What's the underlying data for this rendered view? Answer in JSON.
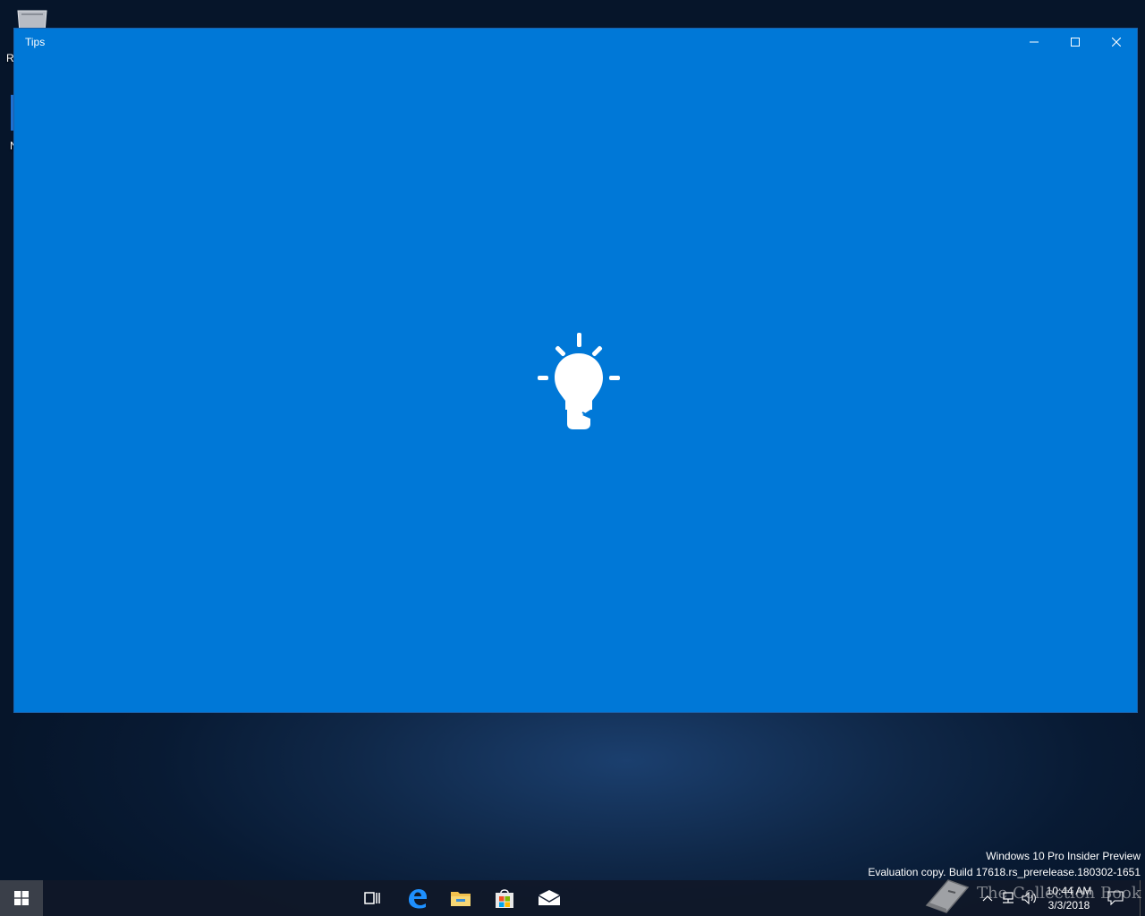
{
  "desktop": {
    "icon_label_1": "R",
    "icon_label_2": "N"
  },
  "window": {
    "title": "Tips",
    "minimize_label": "Minimize",
    "maximize_label": "Maximize",
    "close_label": "Close",
    "background_color": "#0078d7",
    "splash_icon": "lightbulb-icon"
  },
  "watermark": {
    "line1": "Windows 10 Pro Insider Preview",
    "line2": "Evaluation copy. Build 17618.rs_prerelease.180302-1651"
  },
  "taskbar": {
    "apps": [
      {
        "name": "task-view-icon"
      },
      {
        "name": "edge-icon"
      },
      {
        "name": "file-explorer-icon"
      },
      {
        "name": "store-icon"
      },
      {
        "name": "mail-icon"
      }
    ],
    "clock_time": "10:44 AM",
    "clock_date": "3/3/2018",
    "overlay_text": "The Collection Book"
  }
}
